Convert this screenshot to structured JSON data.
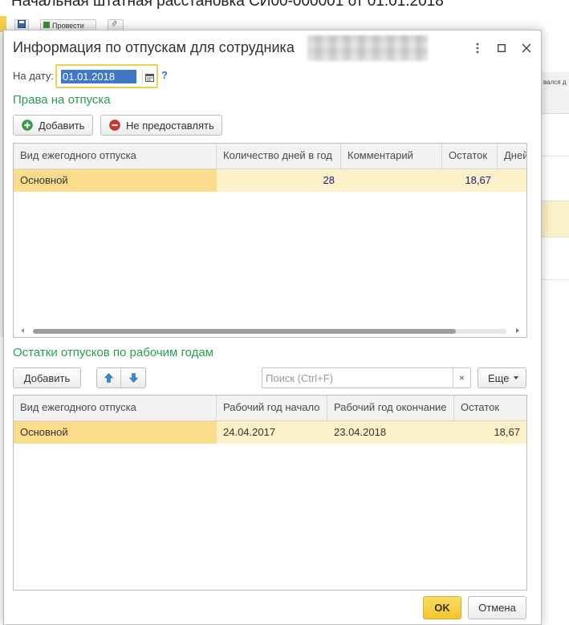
{
  "background": {
    "title": "Начальная штатная расстановка СИ00-000001 от 01.01.2018",
    "toolbar": {
      "post_label": "Провести"
    },
    "column_fragment": "вался д"
  },
  "dialog": {
    "title": "Информация по отпускам для сотрудника",
    "controls": {
      "more": "more-vert-icon",
      "maximize": "maximize-icon",
      "close": "close-icon"
    }
  },
  "date_field": {
    "label": "На дату:",
    "value": "01.01.2018",
    "help": "?"
  },
  "rights": {
    "title": "Права на отпуска",
    "add_label": "Добавить",
    "deny_label": "Не предоставлять",
    "columns": [
      "Вид ежегодного отпуска",
      "Количество дней в год",
      "Комментарий",
      "Остаток",
      "Дней"
    ],
    "rows": [
      {
        "type": "Основной",
        "days": "28",
        "comment": "",
        "balance": "18,67",
        "extra": ""
      }
    ]
  },
  "balances": {
    "title": "Остатки отпусков по рабочим годам",
    "add_label": "Добавить",
    "search_placeholder": "Поиск (Ctrl+F)",
    "clear": "×",
    "more_label": "Еще",
    "columns": [
      "Вид ежегодного отпуска",
      "Рабочий год начало",
      "Рабочий год окончание",
      "Остаток"
    ],
    "rows": [
      {
        "type": "Основной",
        "start": "24.04.2017",
        "end": "23.04.2018",
        "balance": "18,67"
      }
    ]
  },
  "footer": {
    "ok_label": "OK",
    "cancel_label": "Отмена"
  },
  "colors": {
    "section_title": "#2a9d4e",
    "selected_row": "#fbf0c7",
    "selected_cell": "#fbdc8a",
    "accent_yellow": "#f2c52c",
    "date_selection": "#3f78c4",
    "help": "#2b7fd6"
  }
}
